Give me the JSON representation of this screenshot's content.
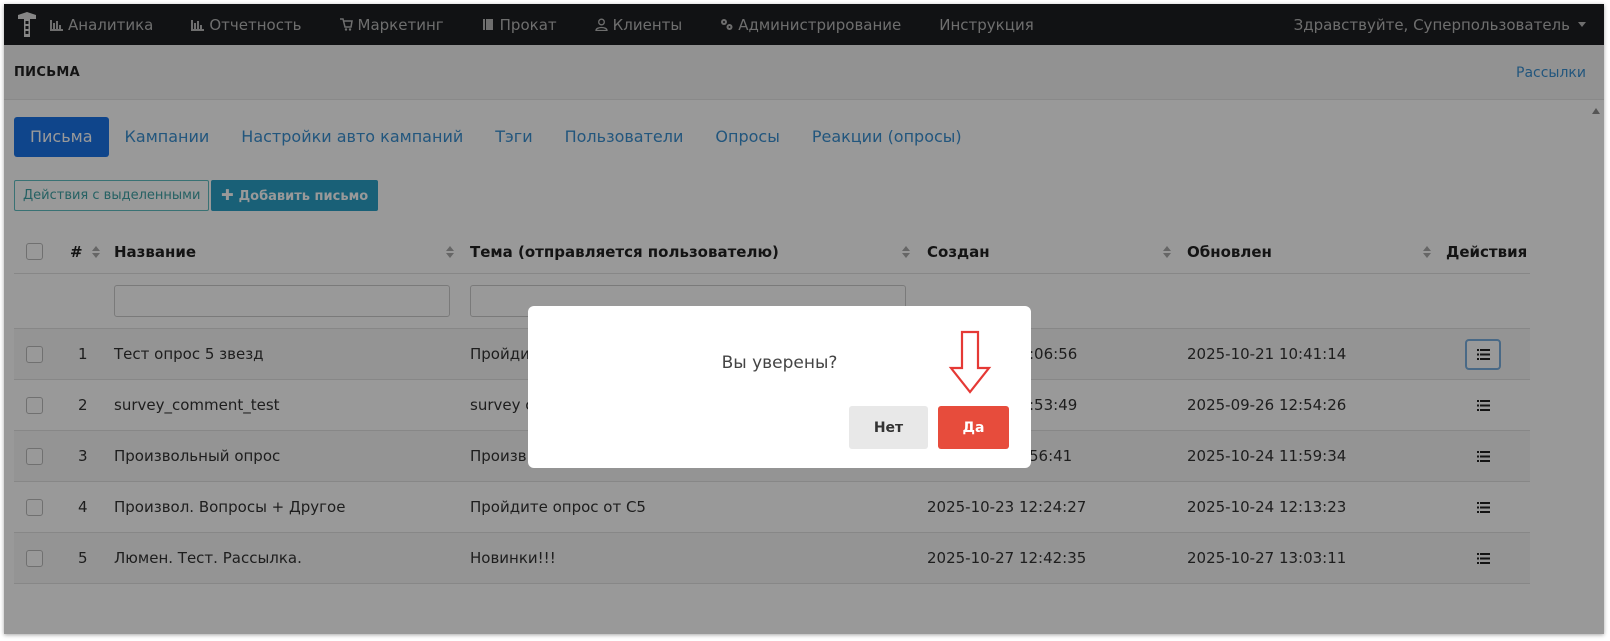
{
  "navbar": {
    "items": [
      {
        "label": "Аналитика",
        "icon": "bar-chart-icon"
      },
      {
        "label": "Отчетность",
        "icon": "bar-chart-icon"
      },
      {
        "label": "Маркетинг",
        "icon": "cart-icon"
      },
      {
        "label": "Прокат",
        "icon": "book-icon"
      },
      {
        "label": "Клиенты",
        "icon": "user-icon"
      },
      {
        "label": "Администрирование",
        "icon": "gears-icon"
      },
      {
        "label": "Инструкция",
        "icon": ""
      }
    ],
    "greeting": "Здравствуйте, Суперпользователь"
  },
  "header": {
    "title": "ПИСЬМА",
    "right_link": "Рассылки"
  },
  "tabs": [
    {
      "label": "Письма",
      "active": true
    },
    {
      "label": "Кампании",
      "active": false
    },
    {
      "label": "Настройки авто кампаний",
      "active": false
    },
    {
      "label": "Тэги",
      "active": false
    },
    {
      "label": "Пользователи",
      "active": false
    },
    {
      "label": "Опросы",
      "active": false
    },
    {
      "label": "Реакции (опросы)",
      "active": false
    }
  ],
  "toolbar": {
    "bulk_actions": "Действия с выделенными",
    "add_letter": "Добавить письмо"
  },
  "table": {
    "columns": {
      "num": "#",
      "name": "Название",
      "subject": "Тема (отправляется пользователю)",
      "created": "Создан",
      "updated": "Обновлен",
      "actions": "Действия"
    },
    "rows": [
      {
        "num": "1",
        "name": "Тест опрос 5 звезд",
        "subject": "Пройдит",
        "created": ":06:56",
        "updated": "2025-10-21 10:41:14"
      },
      {
        "num": "2",
        "name": "survey_comment_test",
        "subject": "survey c",
        "created": ":53:49",
        "updated": "2025-09-26 12:54:26"
      },
      {
        "num": "3",
        "name": "Произвольный опрос",
        "subject": "Произв",
        "created": "56:41",
        "updated": "2025-10-24 11:59:34"
      },
      {
        "num": "4",
        "name": "Произвол. Вопросы + Другое",
        "subject": "Пройдите опрос от С5",
        "created": "2025-10-23 12:24:27",
        "updated": "2025-10-24 12:13:23"
      },
      {
        "num": "5",
        "name": "Люмен. Тест. Рассылка.",
        "subject": "Новинки!!!",
        "created": "2025-10-27 12:42:35",
        "updated": "2025-10-27 13:03:11"
      }
    ]
  },
  "modal": {
    "message": "Вы уверены?",
    "no": "Нет",
    "yes": "Да"
  },
  "colors": {
    "navbar_bg": "#1d1f22",
    "primary": "#1a73e8",
    "link": "#3a8fd1",
    "danger": "#e74c3c"
  }
}
